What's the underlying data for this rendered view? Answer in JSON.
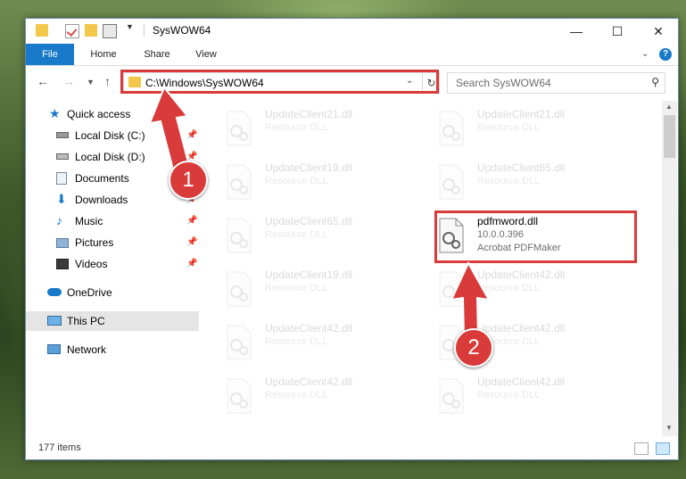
{
  "window": {
    "title": "SysWOW64",
    "controls": {
      "minimize": "—",
      "maximize": "☐",
      "close": "✕"
    }
  },
  "ribbon": {
    "tabs": [
      "File",
      "Home",
      "Share",
      "View"
    ],
    "help": "?"
  },
  "nav": {
    "address": "C:\\Windows\\SysWOW64",
    "search_placeholder": "Search SysWOW64"
  },
  "sidebar": {
    "items": [
      {
        "label": "Quick access",
        "icon": "star-icon",
        "pinned": false
      },
      {
        "label": "Local Disk (C:)",
        "icon": "drive-icon",
        "pinned": true
      },
      {
        "label": "Local Disk (D:)",
        "icon": "drive-icon",
        "pinned": true
      },
      {
        "label": "Documents",
        "icon": "documents-icon",
        "pinned": true
      },
      {
        "label": "Downloads",
        "icon": "download-icon",
        "pinned": true
      },
      {
        "label": "Music",
        "icon": "music-icon",
        "pinned": true
      },
      {
        "label": "Pictures",
        "icon": "pictures-icon",
        "pinned": true
      },
      {
        "label": "Videos",
        "icon": "videos-icon",
        "pinned": true
      },
      {
        "label": "OneDrive",
        "icon": "cloud-icon",
        "pinned": false
      },
      {
        "label": "This PC",
        "icon": "computer-icon",
        "pinned": false,
        "selected": true
      },
      {
        "label": "Network",
        "icon": "network-icon",
        "pinned": false
      }
    ]
  },
  "files": {
    "left_column": [
      {
        "name": "UpdateClient21.dll",
        "type": "Resource DLL"
      },
      {
        "name": "UpdateClient19.dll",
        "type": "Resource DLL"
      },
      {
        "name": "UpdateClient65.dll",
        "type": "Resource DLL"
      },
      {
        "name": "UpdateClient19.dll",
        "type": "Resource DLL"
      },
      {
        "name": "UpdateClient42.dll",
        "type": "Resource DLL"
      },
      {
        "name": "UpdateClient42.dll",
        "type": "Resource DLL"
      }
    ],
    "right_column": [
      {
        "name": "UpdateClient21.dll",
        "type": "Resource DLL"
      },
      {
        "name": "UpdateClient65.dll",
        "type": "Resource DLL"
      },
      {
        "name": "pdfmword.dll",
        "version": "10.0.0.396",
        "type": "Acrobat PDFMaker",
        "highlighted": true
      },
      {
        "name": "UpdateClient42.dll",
        "type": "Resource DLL"
      },
      {
        "name": "UpdateClient42.dll",
        "type": "Resource DLL"
      },
      {
        "name": "UpdateClient42.dll",
        "type": "Resource DLL"
      }
    ]
  },
  "status": {
    "count": "177 items"
  },
  "callouts": [
    "1",
    "2"
  ],
  "colors": {
    "accent": "#1979ca",
    "annotation": "#d93a3a",
    "folder": "#f3c74a"
  }
}
